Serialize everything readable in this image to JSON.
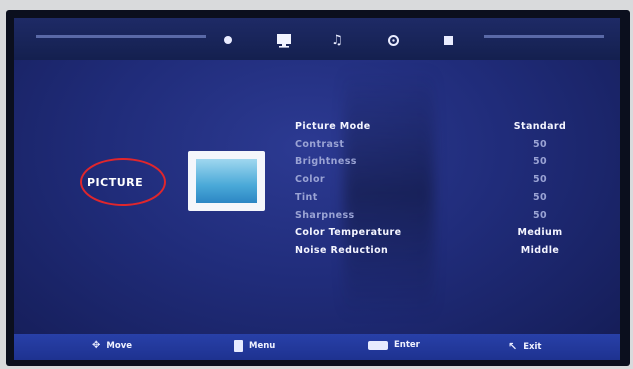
{
  "side_label": "PICTURE",
  "top_icons": [
    "settings-icon",
    "picture-icon",
    "sound-icon",
    "time-icon",
    "lock-icon"
  ],
  "menu": [
    {
      "label": "Picture Mode",
      "value": "Standard",
      "state": "highlighted"
    },
    {
      "label": "Contrast",
      "value": "50",
      "state": "dim"
    },
    {
      "label": "Brightness",
      "value": "50",
      "state": "dim"
    },
    {
      "label": "Color",
      "value": "50",
      "state": "dim"
    },
    {
      "label": "Tint",
      "value": "50",
      "state": "dim"
    },
    {
      "label": "Sharpness",
      "value": "50",
      "state": "dim"
    },
    {
      "label": "Color Temperature",
      "value": "Medium",
      "state": "highlighted"
    },
    {
      "label": "Noise Reduction",
      "value": "Middle",
      "state": "highlighted"
    }
  ],
  "bottom": {
    "move": "Move",
    "menu": "Menu",
    "enter": "Enter",
    "exit": "Exit"
  },
  "colors": {
    "menu_bg": "#202c7a",
    "bottom_bar": "#2840a8",
    "annotation_circle": "#e0262c"
  }
}
